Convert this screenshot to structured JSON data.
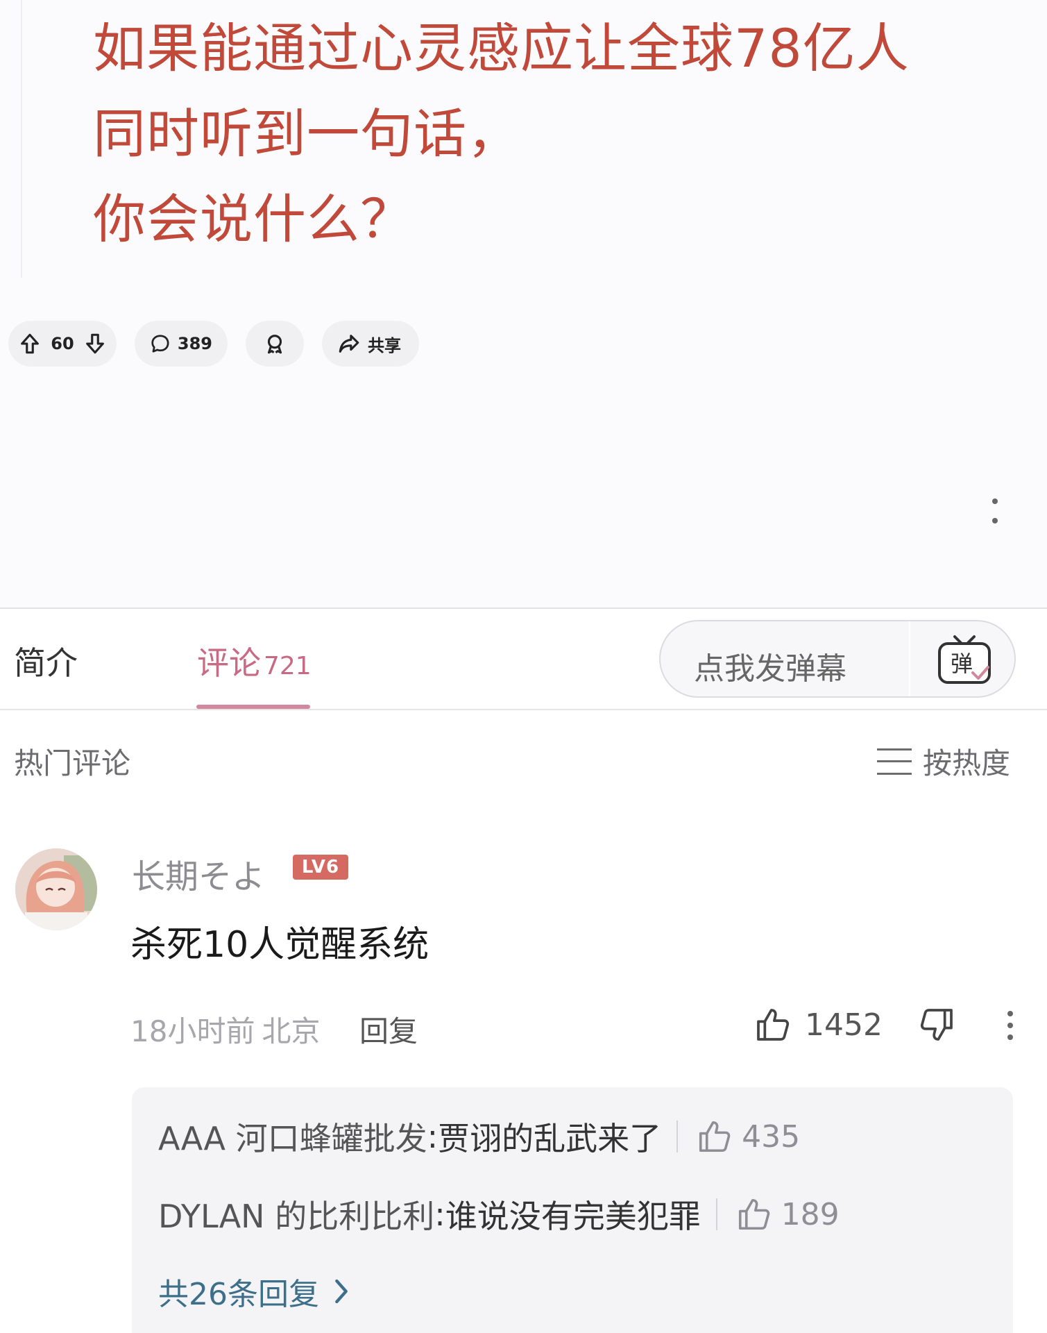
{
  "question": {
    "lines": [
      "如果能通过心灵感应让全球78亿人",
      "同时听到一句话，",
      "你会说什么？"
    ]
  },
  "actions": {
    "vote_count": "60",
    "comment_count": "389",
    "share_label": "共享"
  },
  "tabs": {
    "intro_label": "简介",
    "comments_label": "评论",
    "comments_count": "721"
  },
  "danmaku": {
    "placeholder": "点我发弹幕",
    "icon_char": "弹"
  },
  "comments_header": {
    "title": "热门评论",
    "sort_label": "按热度"
  },
  "comment": {
    "username": "长期そよ",
    "level": "LV6",
    "text": "杀死10人觉醒系统",
    "time": "18小时前",
    "location": "北京",
    "reply_label": "回复",
    "likes": "1452",
    "replies": [
      {
        "who": "AAA 河口蜂罐批发",
        "text": "贾诩的乱武来了",
        "likes": "435"
      },
      {
        "who": "DYLAN 的比利比利",
        "text": "谁说没有完美犯罪",
        "likes": "189"
      }
    ],
    "total_replies": "共26条回复"
  },
  "colors": {
    "question_text": "#c0493a",
    "active_tab": "#c96a85",
    "level_badge": "#d56a63",
    "reply_link": "#3d6f8a"
  }
}
